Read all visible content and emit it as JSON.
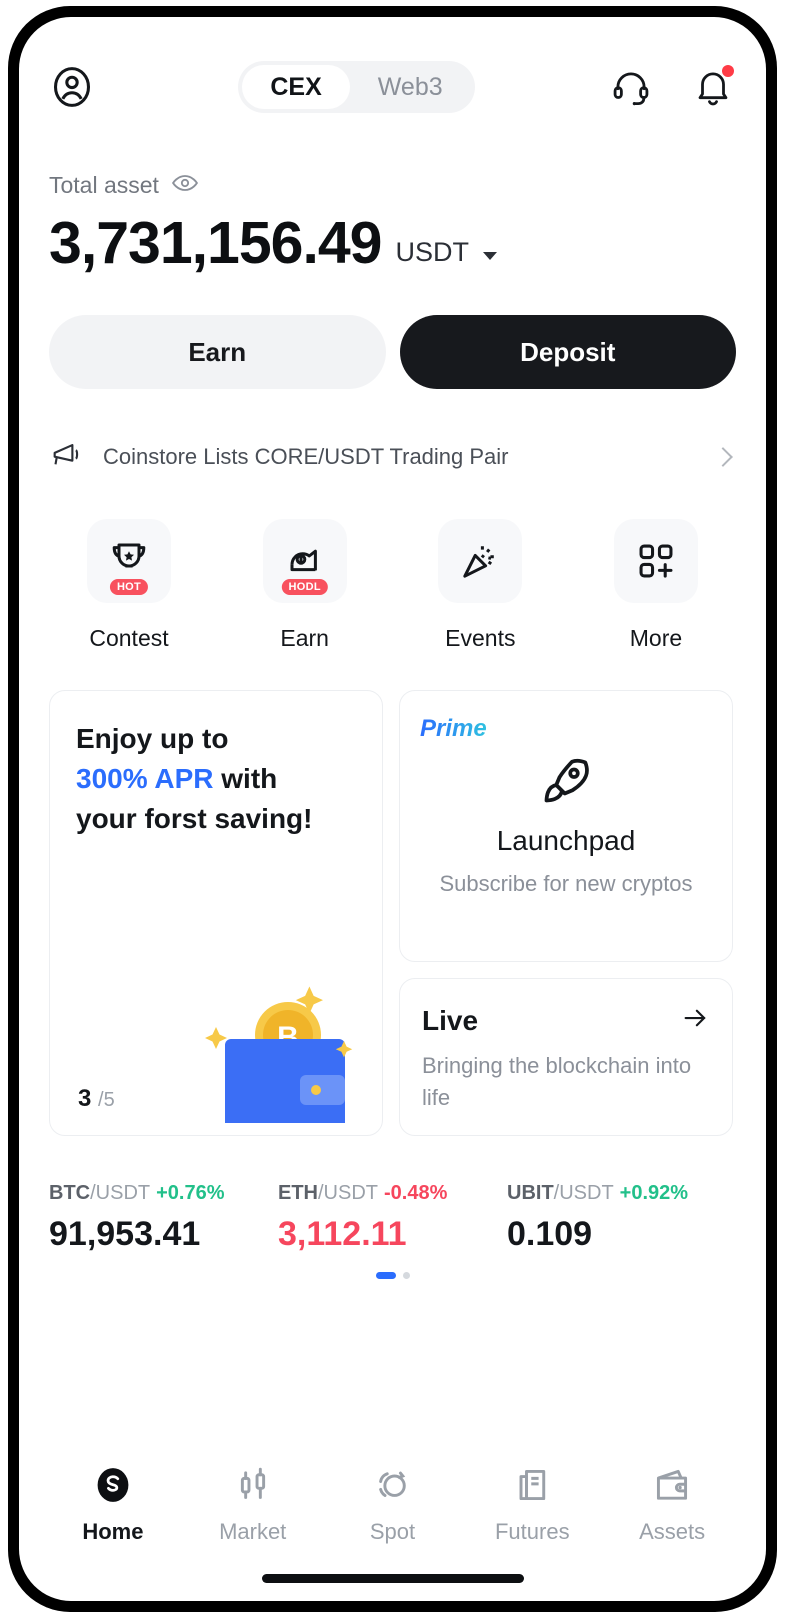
{
  "header": {
    "profile_icon": "user-circle-icon",
    "segments": [
      {
        "label": "CEX",
        "active": true
      },
      {
        "label": "Web3",
        "active": false
      }
    ],
    "support_icon": "headset-icon",
    "notification_icon": "bell-icon",
    "notification_badge": true
  },
  "balance": {
    "label": "Total asset",
    "eye_icon": "eye-icon",
    "amount": "3,731,156.49",
    "currency": "USDT",
    "caret_icon": "chevron-down-icon"
  },
  "actions": {
    "earn_label": "Earn",
    "deposit_label": "Deposit"
  },
  "announcement": {
    "icon": "megaphone-icon",
    "text": "Coinstore Lists CORE/USDT Trading Pair",
    "chevron": "chevron-right-icon"
  },
  "quick_actions": [
    {
      "label": "Contest",
      "icon": "trophy-icon",
      "badge": "HOT"
    },
    {
      "label": "Earn",
      "icon": "piggy-hand-icon",
      "badge": "HODL"
    },
    {
      "label": "Events",
      "icon": "party-popper-icon",
      "badge": ""
    },
    {
      "label": "More",
      "icon": "grid-plus-icon",
      "badge": ""
    }
  ],
  "promo_card": {
    "line1": "Enjoy up to",
    "accent": "300% APR",
    "line2_rest": " with",
    "line3": "your forst saving!",
    "counter_current": "3",
    "counter_total": "/5",
    "art": "wallet-bitcoin-illustration"
  },
  "launchpad_card": {
    "tag": "Prime",
    "icon": "rocket-icon",
    "title": "Launchpad",
    "subtitle": "Subscribe for new cryptos"
  },
  "live_card": {
    "title": "Live",
    "arrow_icon": "arrow-right-icon",
    "subtitle": "Bringing the blockchain into life"
  },
  "ticker": {
    "items": [
      {
        "base": "BTC",
        "quote": "/USDT",
        "change": "+0.76%",
        "direction": "up",
        "price": "91,953.41",
        "price_direction": "neutral"
      },
      {
        "base": "ETH",
        "quote": "/USDT",
        "change": "-0.48%",
        "direction": "down",
        "price": "3,112.11",
        "price_direction": "down"
      },
      {
        "base": "UBIT",
        "quote": "/USDT",
        "change": "+0.92%",
        "direction": "up",
        "price": "0.109",
        "price_direction": "neutral"
      }
    ],
    "page_dots": 2,
    "active_dot": 0
  },
  "bottom_nav": [
    {
      "label": "Home",
      "icon": "home-logo-icon",
      "active": true
    },
    {
      "label": "Market",
      "icon": "candlestick-icon",
      "active": false
    },
    {
      "label": "Spot",
      "icon": "swap-icon",
      "active": false
    },
    {
      "label": "Futures",
      "icon": "document-chart-icon",
      "active": false
    },
    {
      "label": "Assets",
      "icon": "wallet-icon",
      "active": false
    }
  ],
  "colors": {
    "accent_blue": "#2b6dfd",
    "up_green": "#22c08a",
    "down_red": "#f6465d",
    "badge_red": "#f8515e",
    "primary_dark": "#17191d"
  }
}
